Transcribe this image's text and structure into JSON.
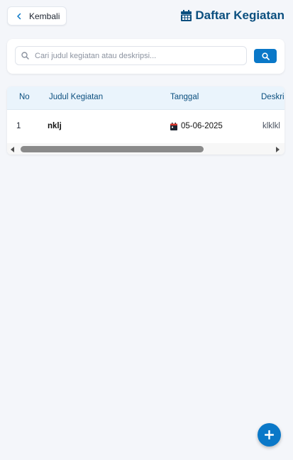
{
  "header": {
    "back_label": "Kembali",
    "title": "Daftar Kegiatan",
    "title_icon": "calendar-icon"
  },
  "search": {
    "placeholder": "Cari judul kegiatan atau deskripsi...",
    "value": ""
  },
  "table": {
    "columns": [
      "No",
      "Judul Kegiatan",
      "Tanggal",
      "Deskri"
    ],
    "rows": [
      {
        "no": "1",
        "title": "nklj",
        "date": "05-06-2025",
        "desc": "klklkl"
      }
    ]
  },
  "colors": {
    "accent": "#0a78c8",
    "title": "#0b4f7f",
    "header_bg": "#eaf4fc",
    "page_bg": "#f4f6fa"
  },
  "fab": {
    "icon": "plus-icon"
  }
}
